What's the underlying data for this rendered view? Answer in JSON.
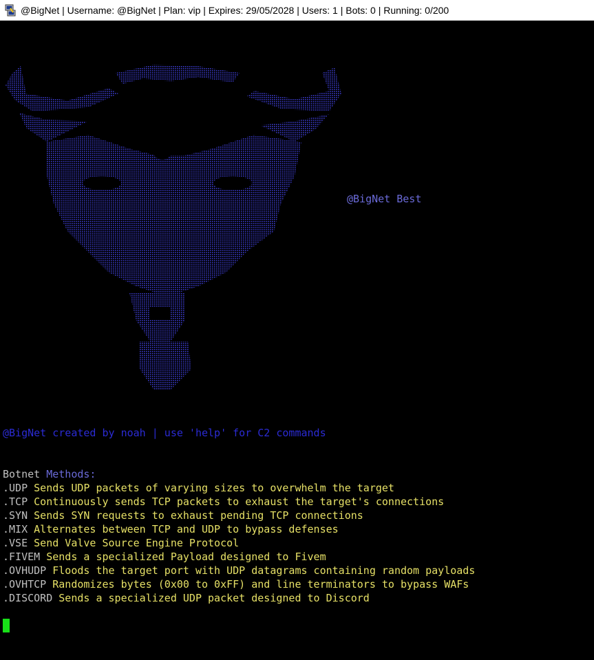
{
  "window": {
    "title": "@BigNet | Username: @BigNet | Plan: vip | Expires: 29/05/2028 | Users: 1 | Bots: 0 | Running: 0/200",
    "icon": "putty-terminal-icon"
  },
  "art": {
    "tagline": "@BigNet Best",
    "color": "#3a3ac8"
  },
  "banner": "@BigNet created by noah | use 'help' for C2 commands",
  "methods_header": {
    "part1": "Botnet",
    "part2": "Methods:"
  },
  "methods": [
    {
      "name": ".UDP",
      "desc": "Sends UDP packets of varying sizes to overwhelm the target"
    },
    {
      "name": ".TCP",
      "desc": "Continuously sends TCP packets to exhaust the target's connections"
    },
    {
      "name": ".SYN",
      "desc": "Sends SYN requests to exhaust pending TCP connections"
    },
    {
      "name": ".MIX",
      "desc": "Alternates between TCP and UDP to bypass defenses"
    },
    {
      "name": ".VSE",
      "desc": "Send Valve Source Engine Protocol"
    },
    {
      "name": ".FIVEM",
      "desc": "Sends a specialized Payload designed to Fivem"
    },
    {
      "name": ".OVHUDP",
      "desc": "Floods the target port with UDP datagrams containing random payloads"
    },
    {
      "name": ".OVHTCP",
      "desc": "Randomizes bytes (0x00 to 0xFF) and line terminators to bypass WAFs"
    },
    {
      "name": ".DISCORD",
      "desc": "Sends a specialized UDP packet designed to Discord"
    }
  ],
  "colors": {
    "banner": "#2b2bd4",
    "method_desc": "#e6e066",
    "cursor": "#18e018"
  }
}
